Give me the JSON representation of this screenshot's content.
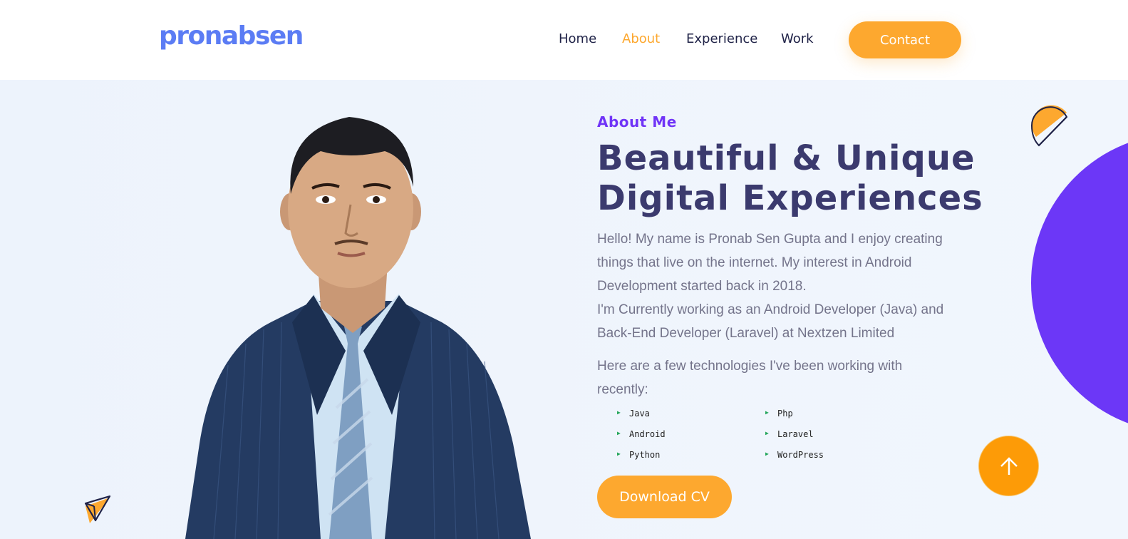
{
  "header": {
    "logo": "pronabsen",
    "nav": [
      {
        "label": "Home",
        "active": false
      },
      {
        "label": "About",
        "active": true
      },
      {
        "label": "Experience",
        "active": false
      },
      {
        "label": "Work",
        "active": false
      }
    ],
    "contact_label": "Contact"
  },
  "about": {
    "label": "About Me",
    "headline_line1": "Beautiful & Unique",
    "headline_line2": "Digital Experiences",
    "intro_p1": "Hello! My name is Pronab Sen Gupta and I enjoy creating things that live on the internet. My interest in Android Development started back in 2018.",
    "intro_p2": "I'm Currently working as an Android Developer (Java) and Back-End Developer (Laravel) at Nextzen Limited",
    "tech_intro": "Here are a few technologies I've been working with recently:",
    "technologies": [
      "Java",
      "Php",
      "Android",
      "Laravel",
      "Python",
      "WordPress"
    ],
    "cv_label": "Download CV"
  },
  "icons": {
    "scroll_top": "arrow-up-icon",
    "bullet": "triangle-bullet-icon",
    "decor_top_right": "half-circle-shape-icon",
    "decor_bottom_left": "paper-plane-shape-icon"
  },
  "colors": {
    "brand": "#5b7cf4",
    "accent": "#fda82f",
    "purple": "#6c37f7",
    "heading": "#3b3a6e",
    "body_text": "#74748b"
  }
}
